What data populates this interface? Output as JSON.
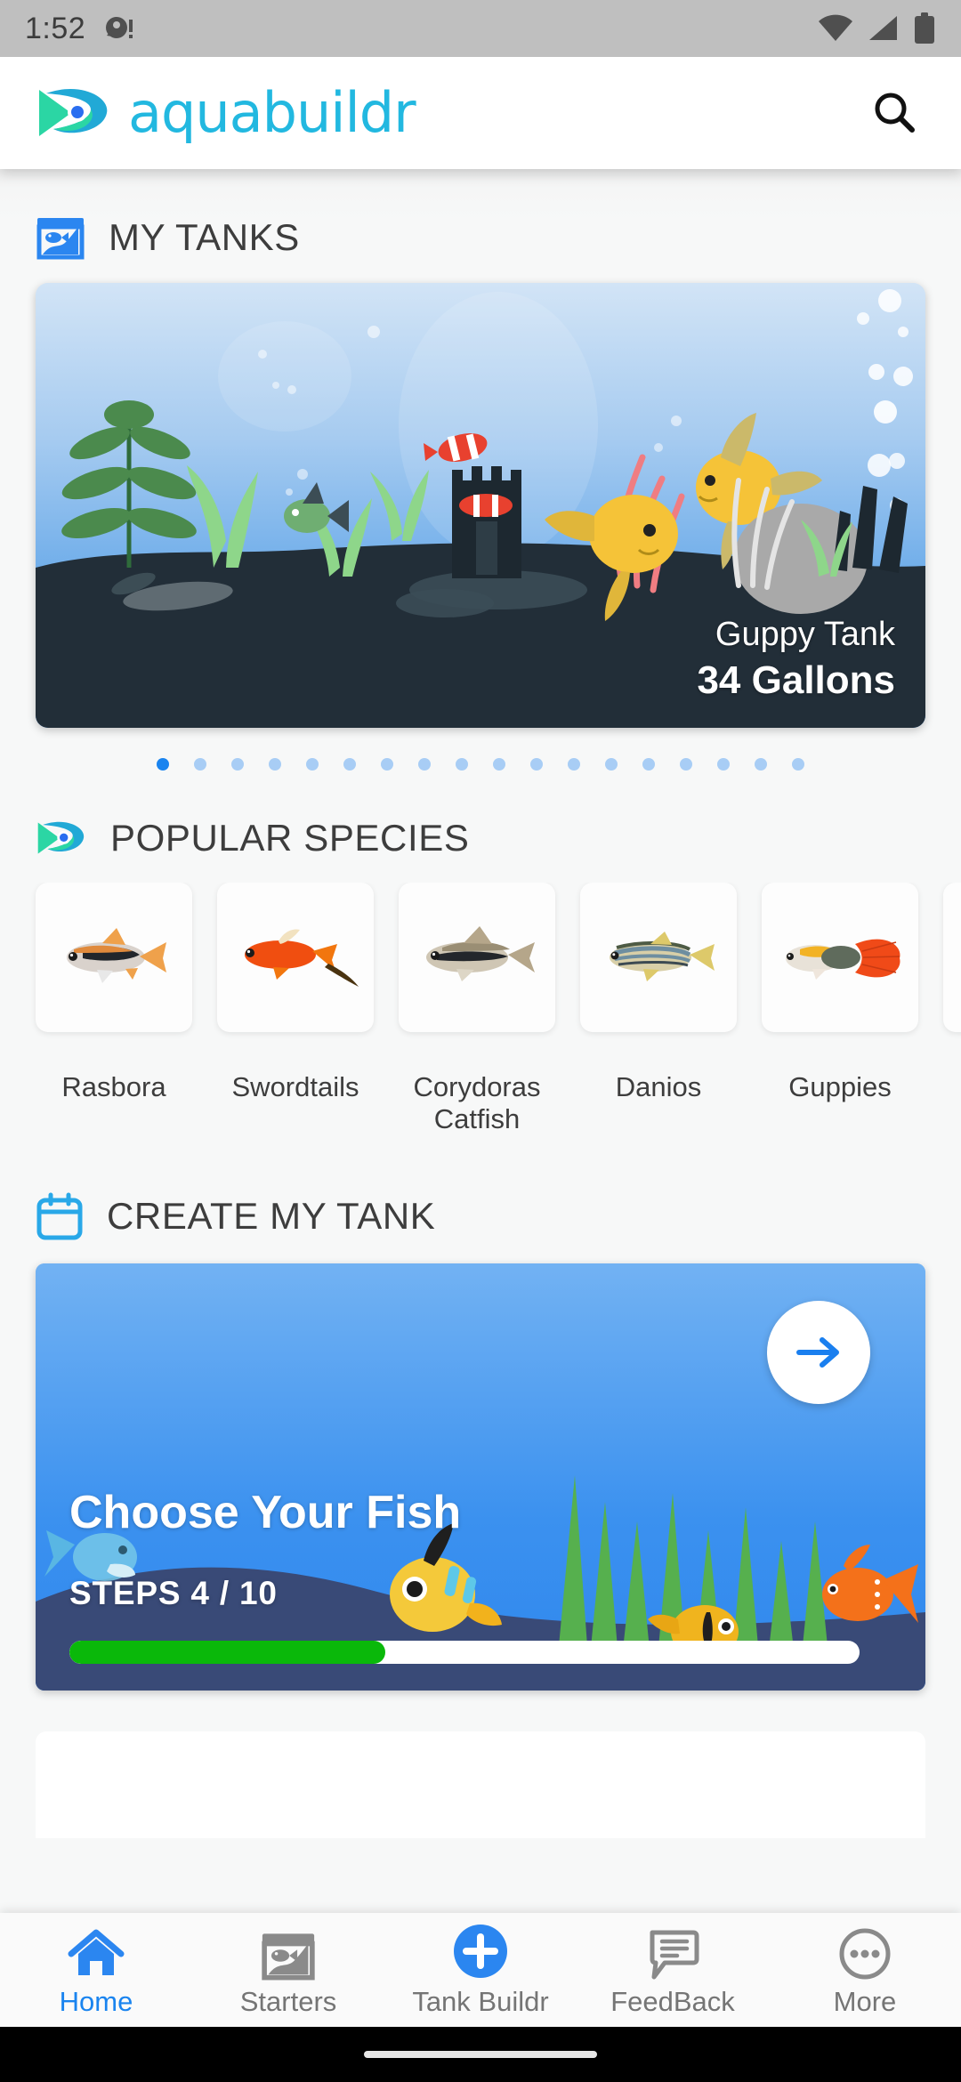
{
  "status_bar": {
    "time": "1:52",
    "left_icons": [
      "notification-dot-icon"
    ],
    "right_icons": [
      "wifi-icon",
      "cellular-signal-icon",
      "battery-icon"
    ]
  },
  "header": {
    "brand_name": "aquabuildr",
    "logo_icon": "fish-logo-icon",
    "search_icon": "search-icon",
    "brand_color": "#22b8e0",
    "logo_colors": [
      "#2bd6a4",
      "#1fa8d8",
      "#2a6ef0"
    ]
  },
  "sections": {
    "my_tanks": {
      "title": "MY TANKS",
      "icon": "aquarium-icon",
      "icon_color": "#2b86f0",
      "tank": {
        "name": "Guppy Tank",
        "volume": "34 Gallons"
      },
      "pagination": {
        "total": 18,
        "active_index": 0,
        "active_color": "#1a84ef",
        "inactive_color": "#a8cdf5"
      }
    },
    "popular_species": {
      "title": "POPULAR SPECIES",
      "icon": "fish-logo-icon",
      "items": [
        {
          "name": "Rasbora",
          "thumb": "rasbora-fish-image"
        },
        {
          "name": "Swordtails",
          "thumb": "swordtail-fish-image"
        },
        {
          "name": "Corydoras\nCatfish",
          "thumb": "corydoras-catfish-image"
        },
        {
          "name": "Danios",
          "thumb": "danio-fish-image"
        },
        {
          "name": "Guppies",
          "thumb": "guppy-fish-image"
        },
        {
          "name": "",
          "thumb": "next-species-image"
        }
      ]
    },
    "create_my_tank": {
      "title": "CREATE MY TANK",
      "icon": "calendar-icon",
      "icon_color": "#29a8e8",
      "card": {
        "title": "Choose Your Fish",
        "steps_label": "STEPS 4 / 10",
        "current_step": 4,
        "total_steps": 10,
        "progress_percent": 40,
        "progress_color": "#0ab80a",
        "next_icon": "arrow-right-icon"
      }
    }
  },
  "bottom_nav": {
    "active_index": 0,
    "active_color": "#1a84ef",
    "items": [
      {
        "label": "Home",
        "icon": "home-icon"
      },
      {
        "label": "Starters",
        "icon": "aquarium-icon"
      },
      {
        "label": "Tank Buildr",
        "icon": "plus-circle-icon"
      },
      {
        "label": "FeedBack",
        "icon": "chat-bubble-icon"
      },
      {
        "label": "More",
        "icon": "ellipsis-icon"
      }
    ]
  }
}
